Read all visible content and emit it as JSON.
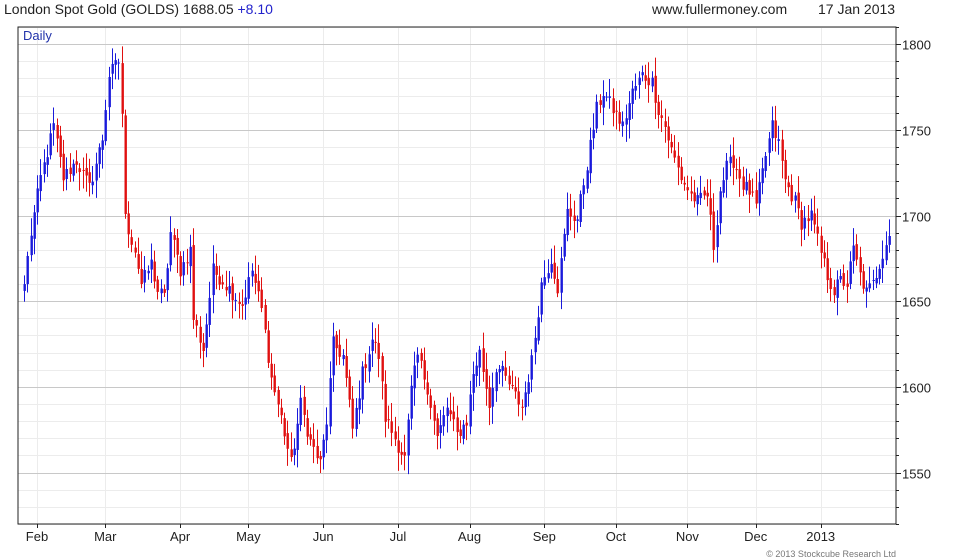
{
  "header": {
    "instrument": "London Spot Gold (GOLDS)",
    "last": "1688.05",
    "change": "+8.10",
    "site": "www.fullermoney.com",
    "date": "17 Jan 2013"
  },
  "footer": {
    "copyright": "© 2013 Stockcube Research Ltd"
  },
  "colors": {
    "up": "#1a1adb",
    "down": "#e01010",
    "grid_major": "#c8c8c8",
    "grid_minor": "#ececec"
  },
  "chart_data": {
    "type": "ohlc",
    "period_label": "Daily",
    "y_axis_side": "right",
    "ylim": [
      1520,
      1810
    ],
    "yticks": [
      1550,
      1600,
      1650,
      1700,
      1750,
      1800
    ],
    "x_labels": [
      "Feb",
      "Mar",
      "Apr",
      "May",
      "Jun",
      "Jul",
      "Aug",
      "Sep",
      "Oct",
      "Nov",
      "Dec",
      "2013"
    ],
    "x_label_bar_index": [
      4,
      25,
      48,
      69,
      92,
      115,
      137,
      160,
      182,
      204,
      225,
      245
    ],
    "grid": true,
    "anchors": [
      [
        0,
        1660
      ],
      [
        2,
        1690
      ],
      [
        5,
        1722
      ],
      [
        9,
        1752
      ],
      [
        12,
        1722
      ],
      [
        16,
        1732
      ],
      [
        20,
        1716
      ],
      [
        24,
        1745
      ],
      [
        26,
        1782
      ],
      [
        29,
        1790
      ],
      [
        30,
        1760
      ],
      [
        31,
        1698
      ],
      [
        34,
        1680
      ],
      [
        36,
        1660
      ],
      [
        39,
        1672
      ],
      [
        41,
        1656
      ],
      [
        43,
        1652
      ],
      [
        45,
        1690
      ],
      [
        48,
        1668
      ],
      [
        51,
        1680
      ],
      [
        52,
        1640
      ],
      [
        55,
        1622
      ],
      [
        58,
        1668
      ],
      [
        61,
        1662
      ],
      [
        64,
        1655
      ],
      [
        67,
        1648
      ],
      [
        70,
        1668
      ],
      [
        73,
        1645
      ],
      [
        76,
        1605
      ],
      [
        79,
        1582
      ],
      [
        82,
        1555
      ],
      [
        85,
        1590
      ],
      [
        88,
        1568
      ],
      [
        91,
        1555
      ],
      [
        93,
        1580
      ],
      [
        95,
        1625
      ],
      [
        98,
        1618
      ],
      [
        101,
        1575
      ],
      [
        104,
        1608
      ],
      [
        107,
        1628
      ],
      [
        109,
        1618
      ],
      [
        111,
        1582
      ],
      [
        114,
        1570
      ],
      [
        117,
        1558
      ],
      [
        119,
        1598
      ],
      [
        121,
        1618
      ],
      [
        124,
        1600
      ],
      [
        127,
        1570
      ],
      [
        130,
        1588
      ],
      [
        133,
        1572
      ],
      [
        136,
        1580
      ],
      [
        138,
        1608
      ],
      [
        140,
        1620
      ],
      [
        143,
        1590
      ],
      [
        145,
        1612
      ],
      [
        147,
        1608
      ],
      [
        150,
        1598
      ],
      [
        153,
        1588
      ],
      [
        156,
        1615
      ],
      [
        159,
        1660
      ],
      [
        162,
        1675
      ],
      [
        164,
        1658
      ],
      [
        167,
        1702
      ],
      [
        170,
        1698
      ],
      [
        173,
        1730
      ],
      [
        176,
        1762
      ],
      [
        178,
        1772
      ],
      [
        181,
        1762
      ],
      [
        184,
        1752
      ],
      [
        187,
        1772
      ],
      [
        190,
        1782
      ],
      [
        193,
        1778
      ],
      [
        195,
        1762
      ],
      [
        197,
        1752
      ],
      [
        199,
        1738
      ],
      [
        202,
        1722
      ],
      [
        205,
        1712
      ],
      [
        207,
        1708
      ],
      [
        210,
        1712
      ],
      [
        212,
        1682
      ],
      [
        214,
        1715
      ],
      [
        216,
        1728
      ],
      [
        218,
        1732
      ],
      [
        221,
        1718
      ],
      [
        223,
        1714
      ],
      [
        225,
        1705
      ],
      [
        228,
        1735
      ],
      [
        230,
        1752
      ],
      [
        232,
        1742
      ],
      [
        234,
        1720
      ],
      [
        237,
        1708
      ],
      [
        239,
        1696
      ],
      [
        242,
        1700
      ],
      [
        245,
        1678
      ],
      [
        247,
        1665
      ],
      [
        249,
        1656
      ],
      [
        251,
        1662
      ],
      [
        253,
        1660
      ],
      [
        255,
        1680
      ],
      [
        257,
        1665
      ],
      [
        259,
        1655
      ],
      [
        261,
        1660
      ],
      [
        263,
        1672
      ],
      [
        265,
        1685
      ],
      [
        266,
        1688.05
      ]
    ]
  }
}
